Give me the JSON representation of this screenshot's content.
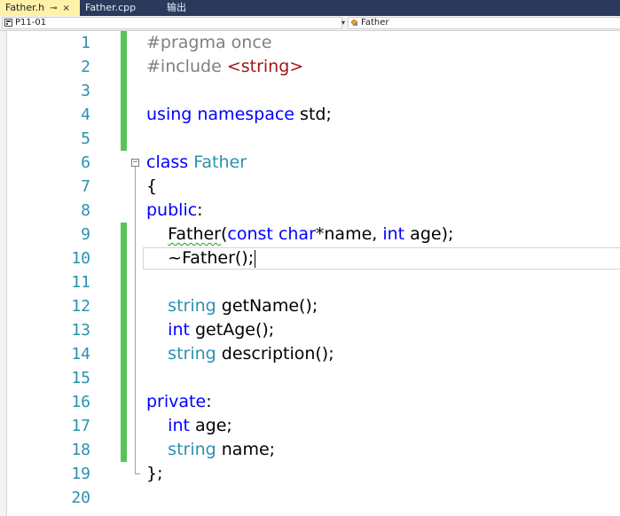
{
  "tabs": [
    {
      "label": "Father.h",
      "pin": "⊸",
      "close": "×",
      "active": true
    },
    {
      "label": "Father.cpp",
      "active": false
    },
    {
      "label": "输出",
      "active": false
    }
  ],
  "navbar": {
    "project": "P11-01",
    "project_icon": "project-icon",
    "scope": "Father",
    "scope_icon": "class-icon"
  },
  "colors": {
    "keyword": "#0000ff",
    "type": "#2b91af",
    "preprocessor": "#808080",
    "string": "#a31515",
    "line_number": "#2b91af",
    "change_bar": "#57c457",
    "tab_bar": "#2b3a5a",
    "active_tab": "#fff1a8"
  },
  "editor": {
    "current_line": 10,
    "lines": [
      {
        "num": "1",
        "tokens": [
          {
            "t": "#pragma once",
            "c": "pp"
          }
        ]
      },
      {
        "num": "2",
        "tokens": [
          {
            "t": "#include ",
            "c": "pp"
          },
          {
            "t": "<string>",
            "c": "st"
          }
        ]
      },
      {
        "num": "3",
        "tokens": []
      },
      {
        "num": "4",
        "tokens": [
          {
            "t": "using",
            "c": "kw"
          },
          {
            "t": " "
          },
          {
            "t": "namespace",
            "c": "kw"
          },
          {
            "t": " std;"
          }
        ]
      },
      {
        "num": "5",
        "tokens": []
      },
      {
        "num": "6",
        "tokens": [
          {
            "t": "class",
            "c": "kw"
          },
          {
            "t": " "
          },
          {
            "t": "Father",
            "c": "ty"
          }
        ]
      },
      {
        "num": "7",
        "tokens": [
          {
            "t": "{"
          }
        ]
      },
      {
        "num": "8",
        "tokens": [
          {
            "t": "public",
            "c": "kw"
          },
          {
            "t": ":"
          }
        ]
      },
      {
        "num": "9",
        "tokens": [
          {
            "t": "    "
          },
          {
            "t": "Father",
            "c": "squig"
          },
          {
            "t": "("
          },
          {
            "t": "const",
            "c": "kw"
          },
          {
            "t": " "
          },
          {
            "t": "char",
            "c": "kw"
          },
          {
            "t": "*name, "
          },
          {
            "t": "int",
            "c": "kw"
          },
          {
            "t": " age);"
          }
        ]
      },
      {
        "num": "10",
        "tokens": [
          {
            "t": "    ~Father();"
          }
        ]
      },
      {
        "num": "11",
        "tokens": []
      },
      {
        "num": "12",
        "tokens": [
          {
            "t": "    "
          },
          {
            "t": "string",
            "c": "ty"
          },
          {
            "t": " getName();"
          }
        ]
      },
      {
        "num": "13",
        "tokens": [
          {
            "t": "    "
          },
          {
            "t": "int",
            "c": "kw"
          },
          {
            "t": " getAge();"
          }
        ]
      },
      {
        "num": "14",
        "tokens": [
          {
            "t": "    "
          },
          {
            "t": "string",
            "c": "ty"
          },
          {
            "t": " description();"
          }
        ]
      },
      {
        "num": "15",
        "tokens": []
      },
      {
        "num": "16",
        "tokens": [
          {
            "t": "private",
            "c": "kw"
          },
          {
            "t": ":"
          }
        ]
      },
      {
        "num": "17",
        "tokens": [
          {
            "t": "    "
          },
          {
            "t": "int",
            "c": "kw"
          },
          {
            "t": " age;"
          }
        ]
      },
      {
        "num": "18",
        "tokens": [
          {
            "t": "    "
          },
          {
            "t": "string",
            "c": "ty"
          },
          {
            "t": " name;"
          }
        ]
      },
      {
        "num": "19",
        "tokens": [
          {
            "t": "};"
          }
        ]
      },
      {
        "num": "20",
        "tokens": []
      }
    ]
  }
}
